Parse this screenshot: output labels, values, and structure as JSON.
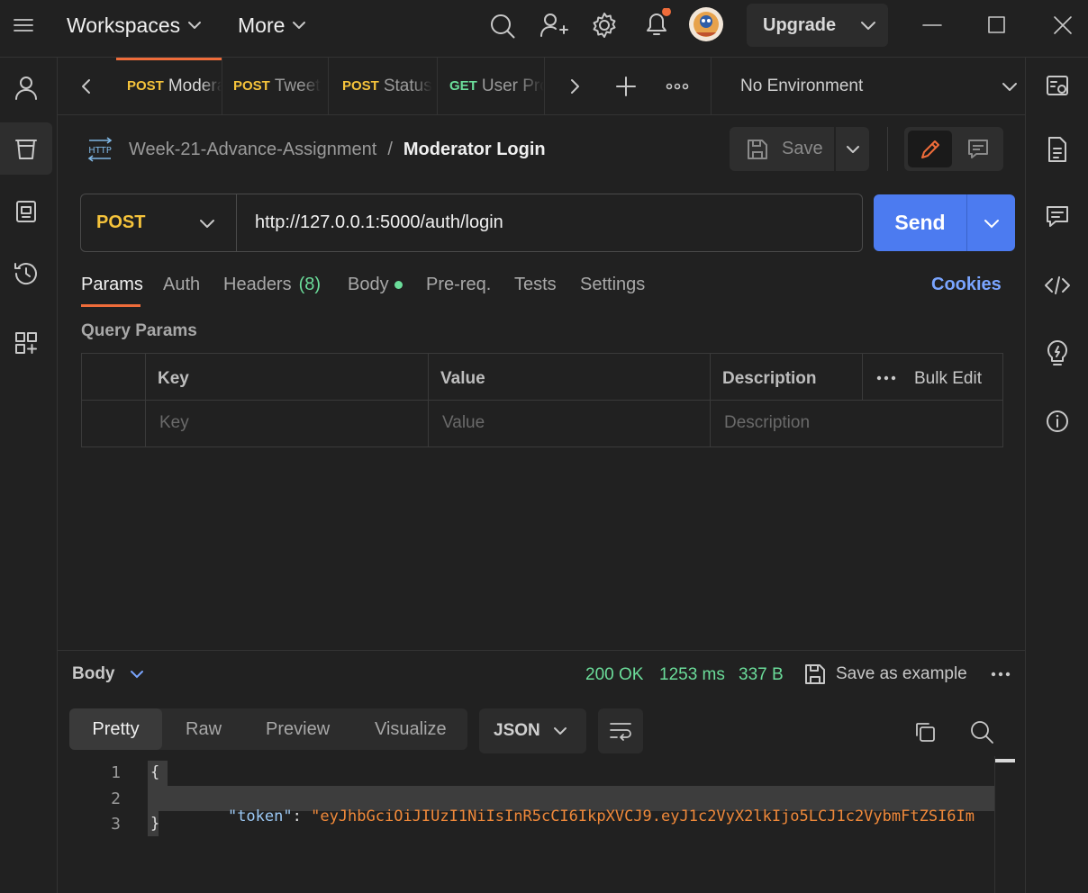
{
  "topbar": {
    "workspaces": "Workspaces",
    "more": "More",
    "upgrade": "Upgrade",
    "notification_color": "#ef6c3a"
  },
  "tabs": [
    {
      "method": "POST",
      "name": "Moderator Login",
      "active": true
    },
    {
      "method": "POST",
      "name": "Tweet",
      "active": false
    },
    {
      "method": "POST",
      "name": "Status",
      "active": false
    },
    {
      "method": "GET",
      "name": "User Profile",
      "active": false
    }
  ],
  "environment": "No Environment",
  "breadcrumb": {
    "collection": "Week-21-Advance-Assignment",
    "separator": "/",
    "request": "Moderator Login",
    "http_label": "HTTP"
  },
  "actions": {
    "save": "Save"
  },
  "request": {
    "method": "POST",
    "url": "http://127.0.0.1:5000/auth/login",
    "send": "Send"
  },
  "request_tabs": {
    "params": "Params",
    "auth": "Auth",
    "headers": "Headers",
    "headers_count": "(8)",
    "body": "Body",
    "prereq": "Pre-req.",
    "tests": "Tests",
    "settings": "Settings",
    "cookies": "Cookies"
  },
  "query_params": {
    "title": "Query Params",
    "columns": {
      "key": "Key",
      "value": "Value",
      "description": "Description"
    },
    "bulk_edit": "Bulk Edit",
    "placeholders": {
      "key": "Key",
      "value": "Value",
      "description": "Description"
    }
  },
  "response": {
    "body_label": "Body",
    "status": "200 OK",
    "time": "1253 ms",
    "size": "337 B",
    "save_example": "Save as example",
    "view_tabs": {
      "pretty": "Pretty",
      "raw": "Raw",
      "preview": "Preview",
      "visualize": "Visualize"
    },
    "format": "JSON",
    "lines": [
      {
        "no": "1",
        "text": "{"
      },
      {
        "no": "2",
        "key": "\"token\"",
        "colon": ": ",
        "value": "\"eyJhbGciOiJIUzI1NiIsInR5cCI6IkpXVCJ9.eyJ1c2VyX2lkIjo5LCJ1c2VybmFtZSI6Im"
      },
      {
        "no": "3",
        "text": "}"
      }
    ]
  },
  "colors": {
    "accent": "#ef6c3a",
    "send": "#4c7bf0",
    "post": "#f5c33b",
    "get": "#6bdd9a",
    "status_ok": "#6bdd9a",
    "cookies": "#7aa5ff"
  }
}
